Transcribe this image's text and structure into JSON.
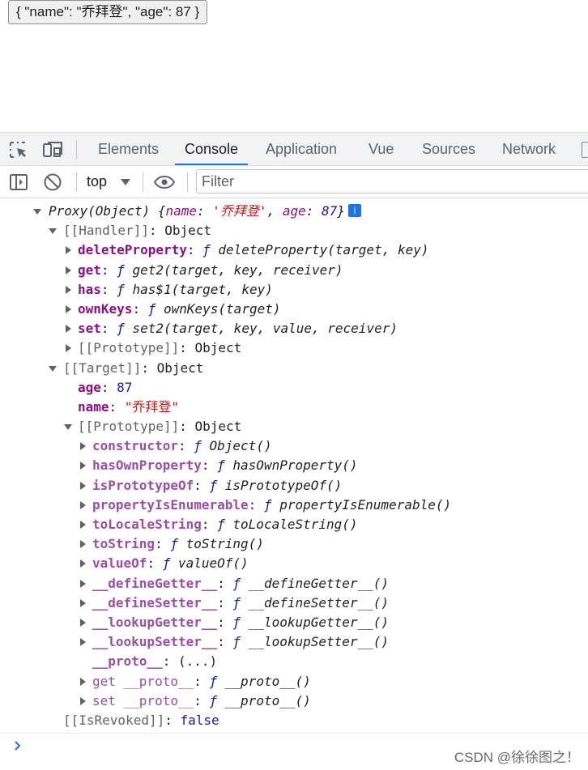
{
  "page": {
    "output_text": "{ \"name\": \"乔拜登\", \"age\": 87 }"
  },
  "devtools": {
    "tabs": [
      {
        "label": "Elements"
      },
      {
        "label": "Console",
        "active": true
      },
      {
        "label": "Application"
      },
      {
        "label": "Vue"
      },
      {
        "label": "Sources"
      },
      {
        "label": "Network"
      }
    ],
    "toolbar": {
      "context": "top",
      "filter_placeholder": "Filter"
    },
    "accent_color": "#1a73e8"
  },
  "console": {
    "proxy_line": {
      "prefix": "Proxy(Object) {",
      "name_key": "name",
      "name_value": "'乔拜登'",
      "age_key": "age",
      "age_value": "87",
      "suffix": "}",
      "info_badge": "i"
    },
    "handler": {
      "label": "[[Handler]]",
      "type": "Object",
      "props": [
        {
          "key": "deleteProperty",
          "value": "deleteProperty(target, key)"
        },
        {
          "key": "get",
          "value": "get2(target, key, receiver)"
        },
        {
          "key": "has",
          "value": "has$1(target, key)"
        },
        {
          "key": "ownKeys",
          "value": "ownKeys(target)"
        },
        {
          "key": "set",
          "value": "set2(target, key, value, receiver)"
        }
      ],
      "prototype_label": "[[Prototype]]",
      "prototype_type": "Object"
    },
    "target": {
      "label": "[[Target]]",
      "type": "Object",
      "age_key": "age",
      "age_value": "87",
      "name_key": "name",
      "name_value": "\"乔拜登\"",
      "prototype_label": "[[Prototype]]",
      "prototype_type": "Object",
      "proto_props": [
        {
          "key": "constructor",
          "value": "Object()"
        },
        {
          "key": "hasOwnProperty",
          "value": "hasOwnProperty()"
        },
        {
          "key": "isPrototypeOf",
          "value": "isPrototypeOf()"
        },
        {
          "key": "propertyIsEnumerable",
          "value": "propertyIsEnumerable()"
        },
        {
          "key": "toLocaleString",
          "value": "toLocaleString()"
        },
        {
          "key": "toString",
          "value": "toString()"
        },
        {
          "key": "valueOf",
          "value": "valueOf()"
        },
        {
          "key": "__defineGetter__",
          "value": "__defineGetter__()"
        },
        {
          "key": "__defineSetter__",
          "value": "__defineSetter__()"
        },
        {
          "key": "__lookupGetter__",
          "value": "__lookupGetter__()"
        },
        {
          "key": "__lookupSetter__",
          "value": "__lookupSetter__()"
        }
      ],
      "proto_accessor": {
        "key": "__proto__",
        "value": "(...)"
      },
      "proto_get": {
        "label": "get __proto__",
        "value": "__proto__()"
      },
      "proto_set": {
        "label": "set __proto__",
        "value": "__proto__()"
      }
    },
    "is_revoked": {
      "label": "[[IsRevoked]]",
      "value": "false"
    },
    "fn_glyph": "ƒ"
  },
  "watermark": "CSDN @徐徐图之！"
}
